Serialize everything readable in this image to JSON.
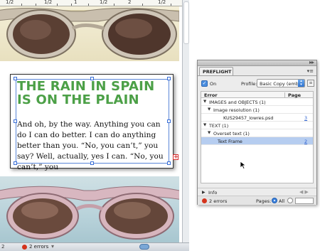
{
  "ruler": {
    "labels": [
      "1/2",
      "1/2",
      "1",
      "1/2",
      "2",
      "1/2"
    ]
  },
  "document": {
    "headline": "THE RAIN IN SPAIN IS ON THE PLAIN",
    "body": "And oh, by the way. Anything you can do I can do better. I can do anything better than you. “No, you can’t,” you say? Well, actually, yes I can. “No, you can’t,” you",
    "overset_marker": "+"
  },
  "panel": {
    "tab_label": "PREFLIGHT",
    "on_label": "On",
    "profile_label": "Profile:",
    "profile_value": "Basic Copy (emb...",
    "columns": {
      "error": "Error",
      "page": "Page"
    },
    "rows": [
      {
        "label": "IMAGES and OBJECTS (1)",
        "page": ""
      },
      {
        "label": "Image resolution (1)",
        "page": ""
      },
      {
        "label": "KUS29457_lowres.psd",
        "page": "3"
      },
      {
        "label": "TEXT (1)",
        "page": ""
      },
      {
        "label": "Overset text (1)",
        "page": ""
      },
      {
        "label": "Text Frame",
        "page": "2"
      }
    ],
    "info_label": "Info",
    "footer": {
      "errors": "2 errors",
      "pages_label": "Pages:",
      "all_label": "All"
    }
  },
  "statusbar": {
    "page_field": "2",
    "errors": "2 errors"
  },
  "colors": {
    "headline": "#4ca047",
    "error_dot": "#d4331c",
    "selection": "#b6cdf0",
    "frame_bounds": "#5a86d8"
  }
}
